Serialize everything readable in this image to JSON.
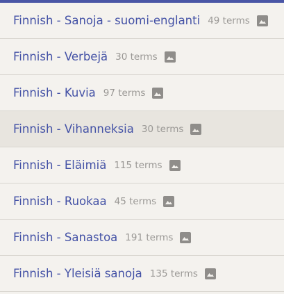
{
  "sets": [
    {
      "title": "Finnish - Sanoja - suomi-englanti",
      "count": "49 terms",
      "icon": "image-icon",
      "active": false
    },
    {
      "title": "Finnish - Verbejä",
      "count": "30 terms",
      "icon": "image-icon",
      "active": false
    },
    {
      "title": "Finnish - Kuvia",
      "count": "97 terms",
      "icon": "image-icon",
      "active": false
    },
    {
      "title": "Finnish - Vihanneksia",
      "count": "30 terms",
      "icon": "image-icon",
      "active": true
    },
    {
      "title": "Finnish - Eläimiä",
      "count": "115 terms",
      "icon": "image-icon",
      "active": false
    },
    {
      "title": "Finnish - Ruokaa",
      "count": "45 terms",
      "icon": "image-icon",
      "active": false
    },
    {
      "title": "Finnish - Sanastoa",
      "count": "191 terms",
      "icon": "image-icon",
      "active": false
    },
    {
      "title": "Finnish - Yleisiä sanoja",
      "count": "135 terms",
      "icon": "image-icon",
      "active": false
    }
  ],
  "colors": {
    "accent": "#4a56a6",
    "title": "#4452a6",
    "count": "#9a9895",
    "icon": "#8f8d8a",
    "background": "#f4f2ee",
    "active_row": "#e8e5df",
    "divider": "#d8d5cf"
  }
}
